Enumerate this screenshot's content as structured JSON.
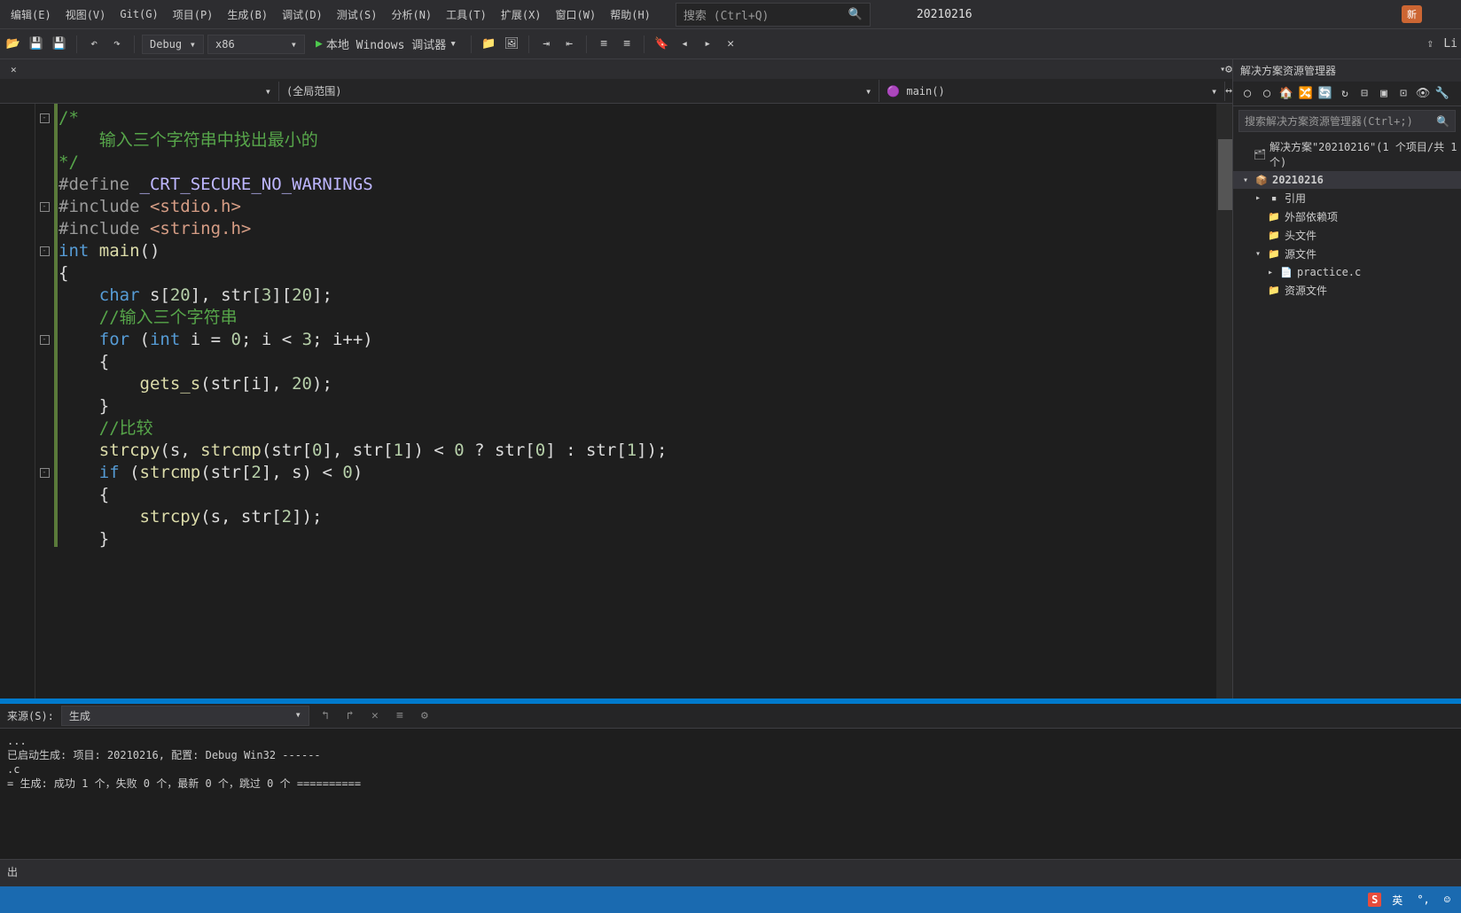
{
  "menubar": {
    "items": [
      "编辑(E)",
      "视图(V)",
      "Git(G)",
      "项目(P)",
      "生成(B)",
      "调试(D)",
      "测试(S)",
      "分析(N)",
      "工具(T)",
      "扩展(X)",
      "窗口(W)",
      "帮助(H)"
    ],
    "search_placeholder": "搜索 (Ctrl+Q)",
    "title": "20210216",
    "new_badge": "新"
  },
  "toolbar": {
    "config": "Debug",
    "platform": "x86",
    "run_label": "本地 Windows 调试器",
    "live_label": "Li"
  },
  "tabs": [],
  "nav": {
    "scope1": "",
    "scope2": "(全局范围)",
    "scope3": "main()"
  },
  "code_lines": [
    {
      "fold": "-",
      "change": true,
      "html": "<span class='c'>/*</span>"
    },
    {
      "fold": "",
      "change": true,
      "html": "    <span class='c'>输入三个字符串中找出最小的</span>"
    },
    {
      "fold": "",
      "change": true,
      "html": "<span class='c'>*/</span>"
    },
    {
      "fold": "",
      "change": true,
      "html": "<span class='p'>#define</span> <span class='m'>_CRT_SECURE_NO_WARNINGS</span>"
    },
    {
      "fold": "-",
      "change": true,
      "html": "<span class='p'>#include</span> <span class='s'>&lt;stdio.h&gt;</span>"
    },
    {
      "fold": "",
      "change": true,
      "html": "<span class='p'>#include</span> <span class='s'>&lt;string.h&gt;</span>"
    },
    {
      "fold": "-",
      "change": true,
      "html": "<span class='k'>int</span> <span class='f'>main</span>()"
    },
    {
      "fold": "",
      "change": true,
      "html": "{"
    },
    {
      "fold": "",
      "change": true,
      "html": "    <span class='k'>char</span> s[<span class='n'>20</span>], str[<span class='n'>3</span>][<span class='n'>20</span>];"
    },
    {
      "fold": "",
      "change": true,
      "html": "    <span class='c'>//输入三个字符串</span>"
    },
    {
      "fold": "-",
      "change": true,
      "html": "    <span class='k'>for</span> (<span class='k'>int</span> i = <span class='n'>0</span>; i &lt; <span class='n'>3</span>; i++)"
    },
    {
      "fold": "",
      "change": true,
      "html": "    {"
    },
    {
      "fold": "",
      "change": true,
      "html": "        <span class='f'>gets_s</span>(str[i], <span class='n'>20</span>);"
    },
    {
      "fold": "",
      "change": true,
      "html": "    }"
    },
    {
      "fold": "",
      "change": true,
      "html": "    <span class='c'>//比较</span>"
    },
    {
      "fold": "",
      "change": true,
      "html": "    <span class='f'>strcpy</span>(s, <span class='f'>strcmp</span>(str[<span class='n'>0</span>], str[<span class='n'>1</span>]) &lt; <span class='n'>0</span> ? str[<span class='n'>0</span>] : str[<span class='n'>1</span>]);"
    },
    {
      "fold": "-",
      "change": true,
      "html": "    <span class='k'>if</span> (<span class='f'>strcmp</span>(str[<span class='n'>2</span>], s) &lt; <span class='n'>0</span>)"
    },
    {
      "fold": "",
      "change": true,
      "html": "    {"
    },
    {
      "fold": "",
      "change": true,
      "html": "        <span class='f'>strcpy</span>(s, str[<span class='n'>2</span>]);"
    },
    {
      "fold": "",
      "change": true,
      "html": "    }"
    }
  ],
  "sidebar": {
    "title": "解决方案资源管理器",
    "search_placeholder": "搜索解决方案资源管理器(Ctrl+;)",
    "tree": [
      {
        "indent": 0,
        "arrow": "",
        "icon": "sln",
        "label": "解决方案\"20210216\"(1 个项目/共 1 个)",
        "bold": false
      },
      {
        "indent": 0,
        "arrow": "▾",
        "icon": "proj",
        "label": "20210216",
        "bold": true,
        "selected": true
      },
      {
        "indent": 1,
        "arrow": "▸",
        "icon": "ref",
        "label": "引用",
        "bold": false
      },
      {
        "indent": 1,
        "arrow": "",
        "icon": "folder",
        "label": "外部依赖项",
        "bold": false
      },
      {
        "indent": 1,
        "arrow": "",
        "icon": "folder",
        "label": "头文件",
        "bold": false
      },
      {
        "indent": 1,
        "arrow": "▾",
        "icon": "folder",
        "label": "源文件",
        "bold": false
      },
      {
        "indent": 2,
        "arrow": "▸",
        "icon": "file",
        "label": "practice.c",
        "bold": false
      },
      {
        "indent": 1,
        "arrow": "",
        "icon": "folder",
        "label": "资源文件",
        "bold": false
      }
    ]
  },
  "output": {
    "source_label": "来源(S):",
    "source_value": "生成",
    "text": "...\n已启动生成: 项目: 20210216, 配置: Debug Win32 ------\n.c\n= 生成: 成功 1 个，失败 0 个，最新 0 个，跳过 0 个 =========="
  },
  "status": {
    "label": "出"
  },
  "taskbar": {
    "ime_lang": "英"
  }
}
